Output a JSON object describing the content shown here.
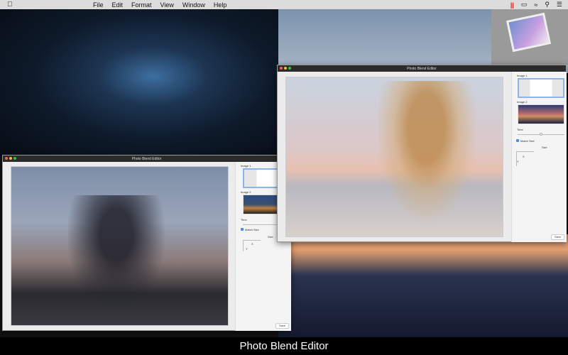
{
  "menubar": {
    "menus": [
      "File",
      "Edit",
      "Format",
      "View",
      "Window",
      "Help"
    ]
  },
  "windows": [
    {
      "title": "Photo Blend Editor",
      "image1_label": "Image 1",
      "image2_label": "Image 2",
      "time_label": "Time",
      "match_size_label": "Match Size",
      "match_size_checked": true,
      "size_label": "Size",
      "x_label": "X",
      "y_label": "Y",
      "save_label": "Save",
      "time_value": 0.85
    },
    {
      "title": "Photo Blend Editor",
      "image1_label": "Image 1",
      "image2_label": "Image 2",
      "time_label": "Time",
      "match_size_label": "Match Size",
      "match_size_checked": true,
      "size_label": "Size",
      "x_label": "X",
      "y_label": "Y",
      "save_label": "Save",
      "time_value": 0.5
    }
  ],
  "caption": "Photo Blend Editor"
}
